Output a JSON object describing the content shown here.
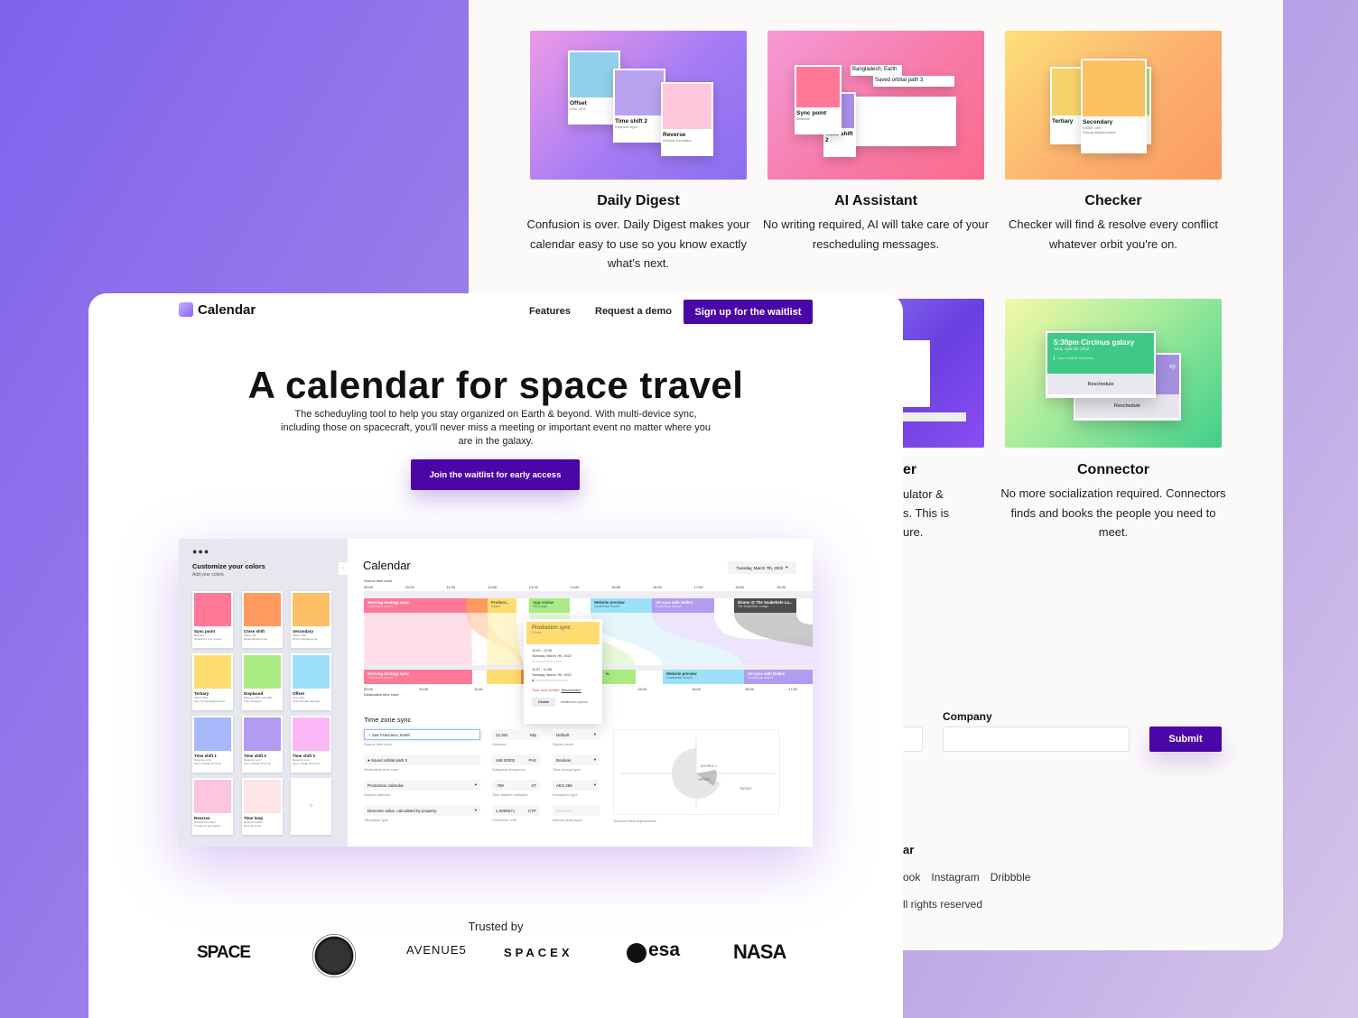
{
  "features": [
    {
      "title": "Daily Digest",
      "desc": "Confusion is over. Daily Digest makes your calendar easy to use so you know exactly what's next.",
      "cards": [
        {
          "name": "Offset",
          "l1": "Over 40%",
          "l2": "Automatically adjusted",
          "color": "#8fd0ea"
        },
        {
          "name": "Time shift 2",
          "l1": "Requires sync",
          "l2": "Sync outside timezone",
          "color": "#b9a3ef"
        },
        {
          "name": "Reverse",
          "l1": "Outside boundary",
          "l2": "Correct for anomalies",
          "color": "#ffc6dc"
        }
      ]
    },
    {
      "title": "AI Assistant",
      "desc": "No writing required, AI will take care of your rescheduling messages.",
      "cards": [
        {
          "name": "Sync point",
          "l1": "Baseline",
          "l2": "Default for sync events",
          "color": "#ff7898"
        },
        {
          "name": "Time shift 2",
          "l1": "Requires sync",
          "l2": "Sync outside timezone",
          "color": "#ab8ee8"
        }
      ],
      "fields": [
        "Bangladesh, Earth",
        "Saved orbital path 3"
      ]
    },
    {
      "title": "Checker",
      "desc": "Checker will find & resolve every conflict whatever orbit you're on.",
      "cards": [
        {
          "name": "Tertiary",
          "l1": "Within 30%",
          "l2": "Very strong",
          "color": "#f6d36a"
        },
        {
          "name": "Secondary",
          "l1": "Within 15%",
          "l2": "Strong displacement",
          "color": "#fbc163"
        },
        {
          "name": "dary",
          "l1": "30% and 40%",
          "l2": "ced",
          "color": "#a8e07c"
        }
      ]
    },
    {
      "title_fragment": "er",
      "desc_fragments": [
        "ulator &",
        "s. This is",
        "ure."
      ]
    },
    {
      "title": "Connector",
      "desc": "No more socialization required. Connectors finds and books the people you need to meet.",
      "event": {
        "title": "5:30pm Circinus galaxy",
        "date": "Wed, April 28, 2022",
        "note": "Sync outside timezone",
        "action": "Reschedule",
        "back_fragment": "xy",
        "back_action": "Reschedule"
      }
    }
  ],
  "form": {
    "company_label": "Company",
    "company_value": "",
    "submit": "Submit"
  },
  "footer": {
    "brand_fragment": "ar",
    "links": [
      "ook",
      "Instagram",
      "Dribbble"
    ],
    "rights_fragment": "ll rights reserved"
  },
  "nav": {
    "brand": "Calendar",
    "features": "Features",
    "demo": "Request a demo",
    "signup": "Sign up for the waitlist"
  },
  "hero": {
    "title": "A calendar for space travel",
    "subtitle": "The scheduyling tool to help you stay organized on Earth & beyond. With multi-device sync, including those on spacecraft, you'll never miss a meeting or important event no matter where you are in the galaxy.",
    "cta": "Join the waitlist for early access"
  },
  "app": {
    "sidebar": {
      "title": "Customize your colors",
      "subtitle": "Add your colors",
      "add": "+",
      "palette": [
        {
          "name": "Sync point",
          "l1": "Baseline",
          "l2": "Default for sync events",
          "color": "#ff7896"
        },
        {
          "name": "Close shift",
          "l1": "Within 5%",
          "l2": "Weak displacement",
          "color": "#ff9a5e"
        },
        {
          "name": "Secondary",
          "l1": "Within 15%",
          "l2": "Strong displacement",
          "color": "#fdc066"
        },
        {
          "name": "Tertiary",
          "l1": "Within 30%",
          "l2": "Very strong displacement",
          "color": "#fedd70"
        },
        {
          "name": "Displaced",
          "l1": "Between 30% and 40%",
          "l2": "Fully displaced",
          "color": "#abeb82"
        },
        {
          "name": "Offset",
          "l1": "Over 40%",
          "l2": "Automatically adjusted",
          "color": "#9de1f8"
        },
        {
          "name": "Time shift 1",
          "l1": "Requires sync",
          "l2": "Sync outside timezone",
          "color": "#a8b8fc"
        },
        {
          "name": "Time shift 2",
          "l1": "Requires sync",
          "l2": "Sync outside timezone",
          "color": "#b19cf2"
        },
        {
          "name": "Time shift 3",
          "l1": "Requires sync",
          "l2": "Sync outside timezone",
          "color": "#fcb8f6"
        },
        {
          "name": "Reverse",
          "l1": "Outside boundary",
          "l2": "Correct for anomalies",
          "color": "#fdc6dc"
        },
        {
          "name": "Time loop",
          "l1": "Repeat function",
          "l2": "Set total loops",
          "color": "#fde4e6"
        }
      ]
    },
    "title": "Calendar",
    "date": "Tuesday, March 7th, 2022",
    "source_label": "Source time zone",
    "dest_label": "Destination time zone",
    "top_hours": [
      "09:00",
      "10:00",
      "11:00",
      "12:00",
      "13:00",
      "14:00",
      "15:00",
      "16:00",
      "17:00",
      "18:00",
      "19:00"
    ],
    "bottom_hours": [
      "09:00",
      "10:00",
      "11:00",
      "14:00",
      "15:00",
      "16:00",
      "17:00"
    ],
    "top_events": [
      {
        "title": "Morning strategy sync",
        "room": "Conference room C",
        "color": "#ff7896"
      },
      {
        "title": "Product...",
        "room": "Orbiter",
        "color": "#fedd70"
      },
      {
        "title": "App review",
        "room": "Tea lounge",
        "color": "#abeb82"
      },
      {
        "title": "Website preview",
        "room": "Conference room B",
        "color": "#9de1f8"
      },
      {
        "title": "UX sync with Didine",
        "room": "Conference room A",
        "color": "#b19cf2"
      },
      {
        "title": "Dinner @ The Snakehole Lo...",
        "room": "The Snakehole Lounge",
        "color": "#4d4d4d"
      }
    ],
    "bottom_events": [
      {
        "title": "Morning strategy sync",
        "room": "Conference room C"
      },
      {
        "title": "w",
        "room": ""
      },
      {
        "title": "Website preview",
        "room": "Conference room B"
      },
      {
        "title": "UX sync with Didine",
        "room": "Conference room A"
      }
    ],
    "popover": {
      "title": "Production sync",
      "room": "Orbiter",
      "src_time": "12:00 - 12:45",
      "src_date": "Tuesday, March 7th, 2022",
      "src_label": "Source time zone",
      "dst_time": "11:07 - 11:58",
      "dst_date": "Tuesday, March 7th, 2022",
      "dst_label": "Destination time zone",
      "conflict": "Time zone conflict.",
      "reschedule": "Reschedule?",
      "create": "Create",
      "more": "Additional options"
    },
    "sync": {
      "heading": "Time zone sync",
      "fields": [
        {
          "value": "San Francisco, Earth",
          "label": "Source time zone"
        },
        {
          "value": "Saved orbital path 3",
          "label": "Destination time zone"
        },
        {
          "value": "Production calendar",
          "label": "Default calendar"
        },
        {
          "value": "Descrete value, calculated by property",
          "label": "Tabulation type"
        }
      ],
      "numbers": [
        {
          "value": "12.301",
          "unit": "Mly",
          "label": "Distance"
        },
        {
          "value": "168.30002",
          "unit": "PHz",
          "label": "Subspace frequency"
        },
        {
          "value": ".769",
          "unit": "XT",
          "label": "Time dilation multiplier"
        },
        {
          "value": "1.0005671",
          "unit": "CTP",
          "label": "Correction shift"
        }
      ],
      "selects": [
        {
          "value": "Default",
          "label": "Signal preset"
        },
        {
          "value": "Boolean",
          "label": "Time prompt type"
        },
        {
          "value": "AES 256",
          "label": "Encryption type"
        },
        {
          "value": "Disabled",
          "label": "Manual array sync"
        }
      ],
      "chart_label": "Temporal field adjustments",
      "chart_marks": [
        "SOURCE 1",
        "OFFSET",
        "TARGET"
      ]
    }
  },
  "trusted": {
    "label": "Trusted by",
    "logos": [
      "SPACE",
      "AVENUE5",
      "SPACEX",
      "esa",
      "NASA"
    ]
  },
  "colors": {
    "accent": "#4a06a6"
  }
}
